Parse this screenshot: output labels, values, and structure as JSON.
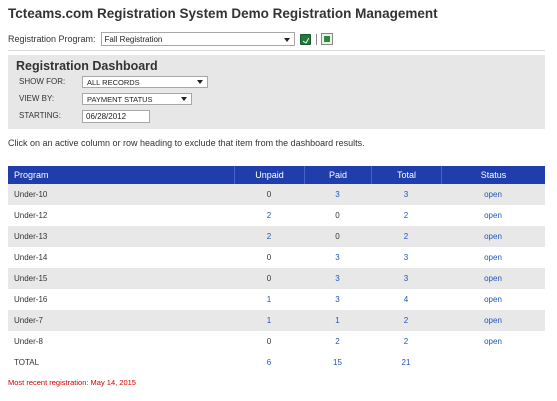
{
  "page_title": "Tcteams.com Registration System Demo Registration Management",
  "program_selector": {
    "label": "Registration Program:",
    "value": "Fall Registration"
  },
  "dashboard": {
    "title": "Registration Dashboard",
    "show_for": {
      "label": "SHOW FOR:",
      "value": "ALL RECORDS"
    },
    "view_by": {
      "label": "VIEW BY:",
      "value": "PAYMENT STATUS"
    },
    "starting": {
      "label": "STARTING:",
      "value": "06/28/2012"
    }
  },
  "instruction": "Click on an active column or row heading to exclude that item from the dashboard results.",
  "table": {
    "columns": [
      "Program",
      "Unpaid",
      "Paid",
      "Total",
      "Status"
    ],
    "rows": [
      {
        "program": "Under-10",
        "unpaid": "0",
        "paid": "3",
        "total": "3",
        "status": "open"
      },
      {
        "program": "Under-12",
        "unpaid": "2",
        "paid": "0",
        "total": "2",
        "status": "open"
      },
      {
        "program": "Under-13",
        "unpaid": "2",
        "paid": "0",
        "total": "2",
        "status": "open"
      },
      {
        "program": "Under-14",
        "unpaid": "0",
        "paid": "3",
        "total": "3",
        "status": "open"
      },
      {
        "program": "Under-15",
        "unpaid": "0",
        "paid": "3",
        "total": "3",
        "status": "open"
      },
      {
        "program": "Under-16",
        "unpaid": "1",
        "paid": "3",
        "total": "4",
        "status": "open"
      },
      {
        "program": "Under-7",
        "unpaid": "1",
        "paid": "1",
        "total": "2",
        "status": "open"
      },
      {
        "program": "Under-8",
        "unpaid": "0",
        "paid": "2",
        "total": "2",
        "status": "open"
      }
    ],
    "totals": {
      "label": "TOTAL",
      "unpaid": "6",
      "paid": "15",
      "total": "21"
    }
  },
  "recent_registration": "Most recent registration: May 14, 2015",
  "colors": {
    "header_bg": "#1f3dab",
    "link": "#2255b8",
    "alert": "#cc0000",
    "panel_bg": "#e7e7e7"
  }
}
